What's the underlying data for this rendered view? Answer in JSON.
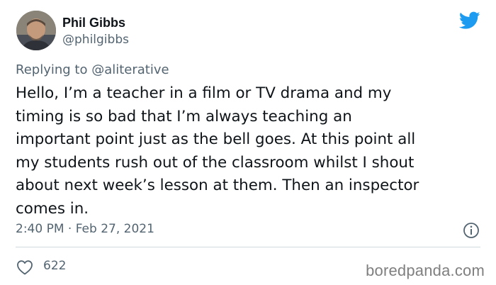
{
  "author": {
    "name": "Phil Gibbs",
    "handle": "@philgibbs"
  },
  "reply": {
    "prefix": "Replying to ",
    "mention": "@aliterative"
  },
  "tweet": {
    "text": "Hello, I’m a teacher in a film or TV drama and my\ntiming is so bad that I’m always teaching an\nimportant point just as the bell goes. At this point all\nmy students rush out of the classroom whilst I shout\nabout next week’s lesson at them. Then an inspector\ncomes in.",
    "timestamp": "2:40 PM · Feb 27, 2021",
    "likes": "622"
  },
  "icons": {
    "brand": "twitter-bird-icon",
    "info": "info-icon",
    "like": "heart-icon"
  },
  "colors": {
    "brand_blue": "#1d9bf0",
    "secondary_text": "#536471",
    "divider": "#cfd9de"
  },
  "watermark": "boredpanda.com"
}
